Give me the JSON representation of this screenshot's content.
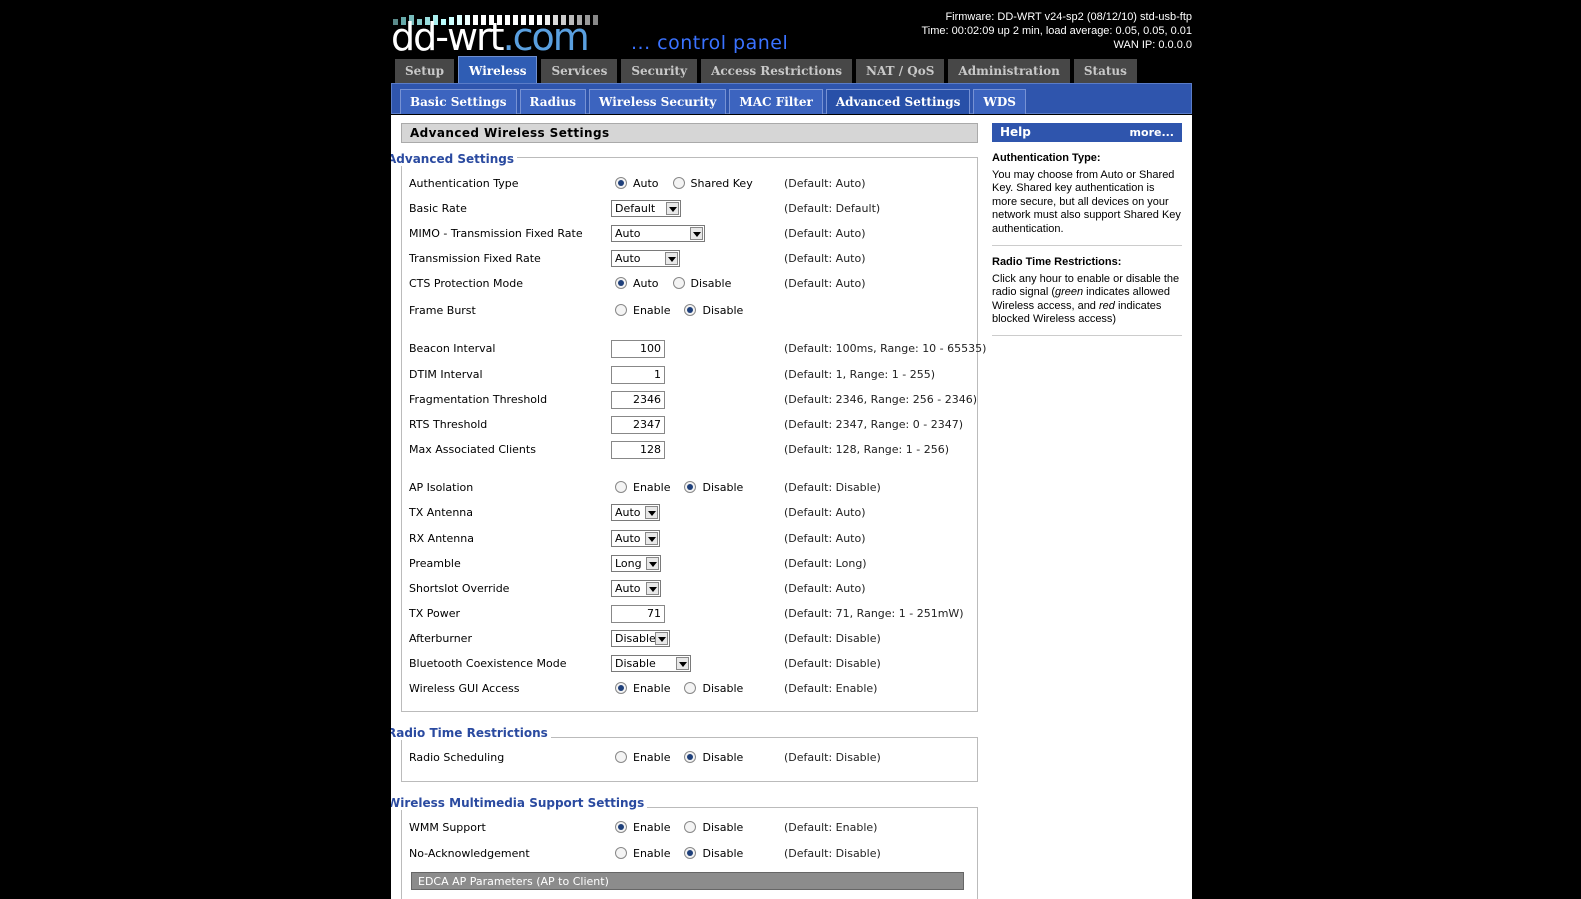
{
  "header": {
    "logo_main": "dd-wrt",
    "logo_com": ".com",
    "tagline": "... control panel",
    "firmware": "Firmware: DD-WRT v24-sp2 (08/12/10) std-usb-ftp",
    "time": "Time: 00:02:09 up 2 min, load average: 0.05, 0.05, 0.01",
    "wan_ip": "WAN IP: 0.0.0.0"
  },
  "main_tabs": [
    "Setup",
    "Wireless",
    "Services",
    "Security",
    "Access Restrictions",
    "NAT / QoS",
    "Administration",
    "Status"
  ],
  "sub_tabs": [
    "Basic Settings",
    "Radius",
    "Wireless Security",
    "MAC Filter",
    "Advanced Settings",
    "WDS"
  ],
  "page_title": "Advanced Wireless Settings",
  "sections": {
    "advanced": "Advanced Settings",
    "radio_time": "Radio Time Restrictions",
    "wmm": "Wireless Multimedia Support Settings"
  },
  "rows": {
    "auth_type": {
      "label": "Authentication Type",
      "opt1": "Auto",
      "opt2": "Shared Key",
      "default": "(Default: Auto)"
    },
    "basic_rate": {
      "label": "Basic Rate",
      "value": "Default",
      "default": "(Default: Default)"
    },
    "mimo_rate": {
      "label": "MIMO - Transmission Fixed Rate",
      "value": "Auto",
      "default": "(Default: Auto)"
    },
    "tx_fixed_rate": {
      "label": "Transmission Fixed Rate",
      "value": "Auto",
      "default": "(Default: Auto)"
    },
    "cts_mode": {
      "label": "CTS Protection Mode",
      "opt1": "Auto",
      "opt2": "Disable",
      "default": "(Default: Auto)"
    },
    "frame_burst": {
      "label": "Frame Burst",
      "opt1": "Enable",
      "opt2": "Disable"
    },
    "beacon": {
      "label": "Beacon Interval",
      "value": "100",
      "default": "(Default: 100ms, Range: 10 - 65535)"
    },
    "dtim": {
      "label": "DTIM Interval",
      "value": "1",
      "default": "(Default: 1, Range: 1 - 255)"
    },
    "frag": {
      "label": "Fragmentation Threshold",
      "value": "2346",
      "default": "(Default: 2346, Range: 256 - 2346)"
    },
    "rts": {
      "label": "RTS Threshold",
      "value": "2347",
      "default": "(Default: 2347, Range: 0 - 2347)"
    },
    "max_clients": {
      "label": "Max Associated Clients",
      "value": "128",
      "default": "(Default: 128, Range: 1 - 256)"
    },
    "ap_isolation": {
      "label": "AP Isolation",
      "opt1": "Enable",
      "opt2": "Disable",
      "default": "(Default: Disable)"
    },
    "tx_antenna": {
      "label": "TX Antenna",
      "value": "Auto",
      "default": "(Default: Auto)"
    },
    "rx_antenna": {
      "label": "RX Antenna",
      "value": "Auto",
      "default": "(Default: Auto)"
    },
    "preamble": {
      "label": "Preamble",
      "value": "Long",
      "default": "(Default: Long)"
    },
    "shortslot": {
      "label": "Shortslot Override",
      "value": "Auto",
      "default": "(Default: Auto)"
    },
    "tx_power": {
      "label": "TX Power",
      "value": "71",
      "default": "(Default: 71, Range: 1 - 251mW)"
    },
    "afterburner": {
      "label": "Afterburner",
      "value": "Disable",
      "default": "(Default: Disable)"
    },
    "bt_coex": {
      "label": "Bluetooth Coexistence Mode",
      "value": "Disable",
      "default": "(Default: Disable)"
    },
    "gui_access": {
      "label": "Wireless GUI Access",
      "opt1": "Enable",
      "opt2": "Disable",
      "default": "(Default: Enable)"
    },
    "radio_sched": {
      "label": "Radio Scheduling",
      "opt1": "Enable",
      "opt2": "Disable",
      "default": "(Default: Disable)"
    },
    "wmm_support": {
      "label": "WMM Support",
      "opt1": "Enable",
      "opt2": "Disable",
      "default": "(Default: Enable)"
    },
    "no_ack": {
      "label": "No-Acknowledgement",
      "opt1": "Enable",
      "opt2": "Disable",
      "default": "(Default: Disable)"
    }
  },
  "edca": "EDCA AP Parameters (AP to Client)",
  "help": {
    "title": "Help",
    "more": "more...",
    "auth_title": "Authentication Type:",
    "auth_text": "You may choose from Auto or Shared Key. Shared key authentication is more secure, but all devices on your network must also support Shared Key authentication.",
    "radio_title": "Radio Time Restrictions:",
    "radio_text_1": "Click any hour to enable or disable the radio signal (",
    "radio_green": "green",
    "radio_text_2": " indicates allowed Wireless access, and ",
    "radio_red": "red",
    "radio_text_3": " indicates blocked Wireless access)"
  },
  "colors": {
    "accent_blue": "#2f55ad",
    "tab_grey": "#474747",
    "logo_teal": "#5aa0e0",
    "legend_blue": "#2a4aa0"
  }
}
